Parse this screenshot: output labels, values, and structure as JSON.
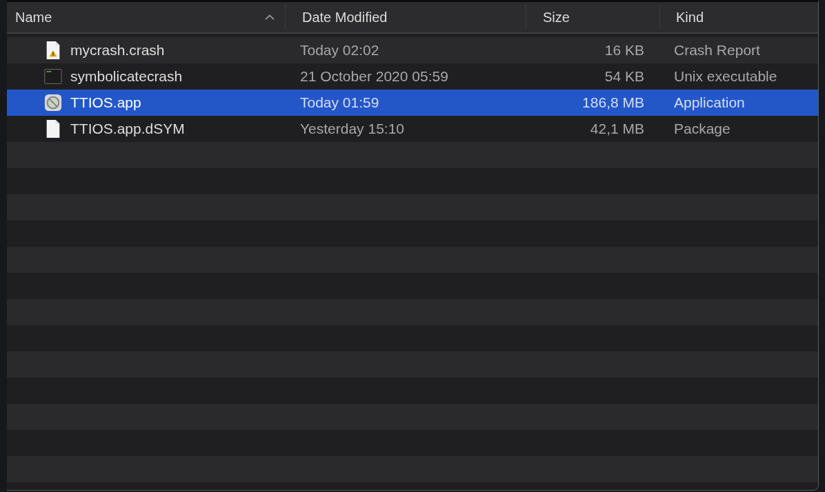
{
  "table": {
    "columns": [
      {
        "label": "Name",
        "sorted": true
      },
      {
        "label": "Date Modified",
        "sorted": false
      },
      {
        "label": "Size",
        "sorted": false
      },
      {
        "label": "Kind",
        "sorted": false
      }
    ],
    "rows": [
      {
        "name": "mycrash.crash",
        "kind": "crash-report",
        "date": "Today 02:02",
        "size": "16 KB",
        "type": "Crash Report",
        "selected": false
      },
      {
        "name": "symbolicatecrash",
        "kind": "executable",
        "date": "21 October 2020 05:59",
        "size": "54 KB",
        "type": "Unix executable",
        "selected": false
      },
      {
        "name": "TTIOS.app",
        "kind": "app",
        "date": "Today 01:59",
        "size": "186,8 MB",
        "type": "Application",
        "selected": true
      },
      {
        "name": "TTIOS.app.dSYM",
        "kind": "document",
        "date": "Yesterday 15:10",
        "size": "42,1 MB",
        "type": "Package",
        "selected": false
      }
    ]
  }
}
